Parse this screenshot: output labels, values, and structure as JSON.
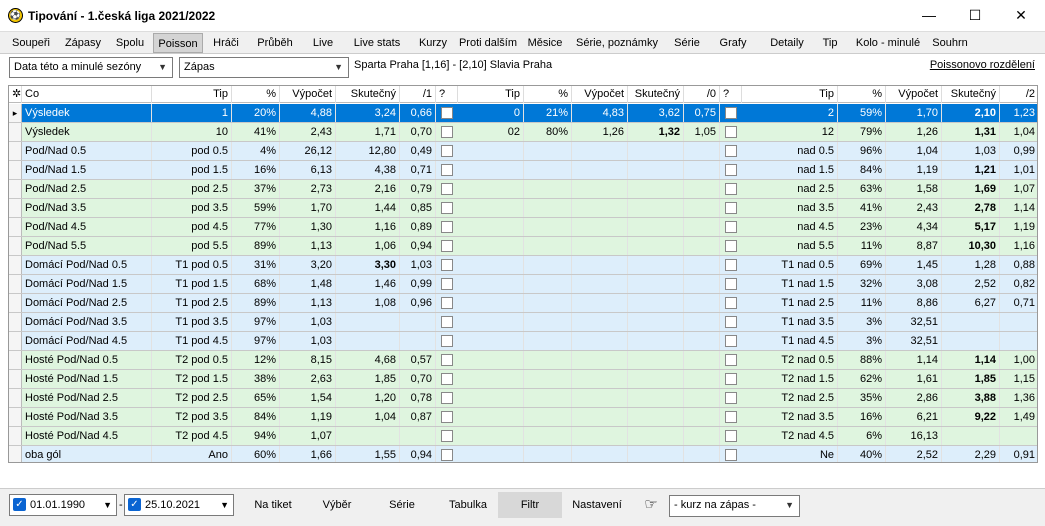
{
  "window": {
    "title": "Tipování - 1.česká liga 2021/2022",
    "icon": "soccer-ball-icon",
    "minimize": "—",
    "maximize": "☐",
    "close": "✕"
  },
  "tabs": [
    "Soupeři",
    "Zápasy",
    "Spolu",
    "Poisson",
    "Hráči",
    "Průběh",
    "Live",
    "Live stats",
    "Kurzy",
    "Proti dalším",
    "Měsice",
    "Série, poznámky",
    "Série",
    "Grafy",
    "Detaily",
    "Tip",
    "Kolo - minulé",
    "Souhrn"
  ],
  "active_tab": "Poisson",
  "filters": {
    "season": "Data této a minulé sezóny",
    "scope": "Zápas",
    "match": "Sparta Praha [1,16] - [2,10] Slavia Praha",
    "poisson_link": "Poissonovo rozdělení"
  },
  "headers": [
    "Co",
    "Tip",
    "%",
    "Výpočet",
    "Skutečný",
    "/1",
    "?",
    "Tip",
    "%",
    "Výpočet",
    "Skutečný",
    "/0",
    "?",
    "Tip",
    "%",
    "Výpočet",
    "Skutečný",
    "/2"
  ],
  "rows": [
    {
      "bg": "sel",
      "c": [
        "Výsledek",
        "1",
        "20%",
        "4,88",
        "3,24",
        "0,66",
        "",
        "0",
        "21%",
        "4,83",
        "3,62",
        "0,75",
        "",
        "2",
        "59%",
        "1,70",
        "2,10",
        "1,23"
      ],
      "b": [
        16
      ]
    },
    {
      "bg": "g",
      "c": [
        "Výsledek",
        "10",
        "41%",
        "2,43",
        "1,71",
        "0,70",
        "",
        "02",
        "80%",
        "1,26",
        "1,32",
        "1,05",
        "",
        "12",
        "79%",
        "1,26",
        "1,31",
        "1,04"
      ],
      "b": [
        10,
        16
      ]
    },
    {
      "bg": "b",
      "c": [
        "Pod/Nad 0.5",
        "pod 0.5",
        "4%",
        "26,12",
        "12,80",
        "0,49",
        "",
        "",
        "",
        "",
        "",
        "",
        "",
        "nad 0.5",
        "96%",
        "1,04",
        "1,03",
        "0,99"
      ],
      "b": []
    },
    {
      "bg": "b",
      "c": [
        "Pod/Nad 1.5",
        "pod 1.5",
        "16%",
        "6,13",
        "4,38",
        "0,71",
        "",
        "",
        "",
        "",
        "",
        "",
        "",
        "nad 1.5",
        "84%",
        "1,19",
        "1,21",
        "1,01"
      ],
      "b": [
        16
      ]
    },
    {
      "bg": "g",
      "c": [
        "Pod/Nad 2.5",
        "pod 2.5",
        "37%",
        "2,73",
        "2,16",
        "0,79",
        "",
        "",
        "",
        "",
        "",
        "",
        "",
        "nad 2.5",
        "63%",
        "1,58",
        "1,69",
        "1,07"
      ],
      "b": [
        16
      ]
    },
    {
      "bg": "g",
      "c": [
        "Pod/Nad 3.5",
        "pod 3.5",
        "59%",
        "1,70",
        "1,44",
        "0,85",
        "",
        "",
        "",
        "",
        "",
        "",
        "",
        "nad 3.5",
        "41%",
        "2,43",
        "2,78",
        "1,14"
      ],
      "b": [
        16
      ]
    },
    {
      "bg": "g",
      "c": [
        "Pod/Nad 4.5",
        "pod 4.5",
        "77%",
        "1,30",
        "1,16",
        "0,89",
        "",
        "",
        "",
        "",
        "",
        "",
        "",
        "nad 4.5",
        "23%",
        "4,34",
        "5,17",
        "1,19"
      ],
      "b": [
        16
      ]
    },
    {
      "bg": "g",
      "c": [
        "Pod/Nad 5.5",
        "pod 5.5",
        "89%",
        "1,13",
        "1,06",
        "0,94",
        "",
        "",
        "",
        "",
        "",
        "",
        "",
        "nad 5.5",
        "11%",
        "8,87",
        "10,30",
        "1,16"
      ],
      "b": [
        16
      ]
    },
    {
      "bg": "b",
      "c": [
        "Domácí Pod/Nad 0.5",
        "T1 pod 0.5",
        "31%",
        "3,20",
        "3,30",
        "1,03",
        "",
        "",
        "",
        "",
        "",
        "",
        "",
        "T1 nad 0.5",
        "69%",
        "1,45",
        "1,28",
        "0,88"
      ],
      "b": [
        4
      ]
    },
    {
      "bg": "b",
      "c": [
        "Domácí Pod/Nad 1.5",
        "T1 pod 1.5",
        "68%",
        "1,48",
        "1,46",
        "0,99",
        "",
        "",
        "",
        "",
        "",
        "",
        "",
        "T1 nad 1.5",
        "32%",
        "3,08",
        "2,52",
        "0,82"
      ],
      "b": []
    },
    {
      "bg": "b",
      "c": [
        "Domácí Pod/Nad 2.5",
        "T1 pod 2.5",
        "89%",
        "1,13",
        "1,08",
        "0,96",
        "",
        "",
        "",
        "",
        "",
        "",
        "",
        "T1 nad 2.5",
        "11%",
        "8,86",
        "6,27",
        "0,71"
      ],
      "b": []
    },
    {
      "bg": "b",
      "c": [
        "Domácí Pod/Nad 3.5",
        "T1 pod 3.5",
        "97%",
        "1,03",
        "",
        "",
        "",
        "",
        "",
        "",
        "",
        "",
        "",
        "T1 nad 3.5",
        "3%",
        "32,51",
        "",
        ""
      ],
      "b": []
    },
    {
      "bg": "b",
      "c": [
        "Domácí Pod/Nad 4.5",
        "T1 pod 4.5",
        "97%",
        "1,03",
        "",
        "",
        "",
        "",
        "",
        "",
        "",
        "",
        "",
        "T1 nad 4.5",
        "3%",
        "32,51",
        "",
        ""
      ],
      "b": []
    },
    {
      "bg": "g",
      "c": [
        "Hosté Pod/Nad 0.5",
        "T2 pod 0.5",
        "12%",
        "8,15",
        "4,68",
        "0,57",
        "",
        "",
        "",
        "",
        "",
        "",
        "",
        "T2 nad 0.5",
        "88%",
        "1,14",
        "1,14",
        "1,00"
      ],
      "b": [
        16
      ]
    },
    {
      "bg": "g",
      "c": [
        "Hosté Pod/Nad 1.5",
        "T2 pod 1.5",
        "38%",
        "2,63",
        "1,85",
        "0,70",
        "",
        "",
        "",
        "",
        "",
        "",
        "",
        "T2 nad 1.5",
        "62%",
        "1,61",
        "1,85",
        "1,15"
      ],
      "b": [
        16
      ]
    },
    {
      "bg": "g",
      "c": [
        "Hosté Pod/Nad 2.5",
        "T2 pod 2.5",
        "65%",
        "1,54",
        "1,20",
        "0,78",
        "",
        "",
        "",
        "",
        "",
        "",
        "",
        "T2 nad 2.5",
        "35%",
        "2,86",
        "3,88",
        "1,36"
      ],
      "b": [
        16
      ]
    },
    {
      "bg": "g",
      "c": [
        "Hosté Pod/Nad 3.5",
        "T2 pod 3.5",
        "84%",
        "1,19",
        "1,04",
        "0,87",
        "",
        "",
        "",
        "",
        "",
        "",
        "",
        "T2 nad 3.5",
        "16%",
        "6,21",
        "9,22",
        "1,49"
      ],
      "b": [
        16
      ]
    },
    {
      "bg": "g",
      "c": [
        "Hosté Pod/Nad 4.5",
        "T2 pod 4.5",
        "94%",
        "1,07",
        "",
        "",
        "",
        "",
        "",
        "",
        "",
        "",
        "",
        "T2 nad 4.5",
        "6%",
        "16,13",
        "",
        ""
      ],
      "b": []
    },
    {
      "bg": "b",
      "c": [
        "oba gól",
        "Ano",
        "60%",
        "1,66",
        "1,55",
        "0,94",
        "",
        "",
        "",
        "",
        "",
        "",
        "",
        "Ne",
        "40%",
        "2,52",
        "2,29",
        "0,91"
      ],
      "b": []
    }
  ],
  "bottom": {
    "date_from": "01.01.1990",
    "dash": "-",
    "date_to": "25.10.2021",
    "buttons": [
      "Na tiket",
      "Výběr",
      "Série",
      "Tabulka",
      "Filtr",
      "Nastavení"
    ],
    "active_button": "Filtr",
    "odds_dropdown": "- kurz na zápas -",
    "hand_icon": "☞"
  },
  "colors": {
    "selected": "#0078d7",
    "green": "#dff5df",
    "blue": "#ddeefb"
  }
}
